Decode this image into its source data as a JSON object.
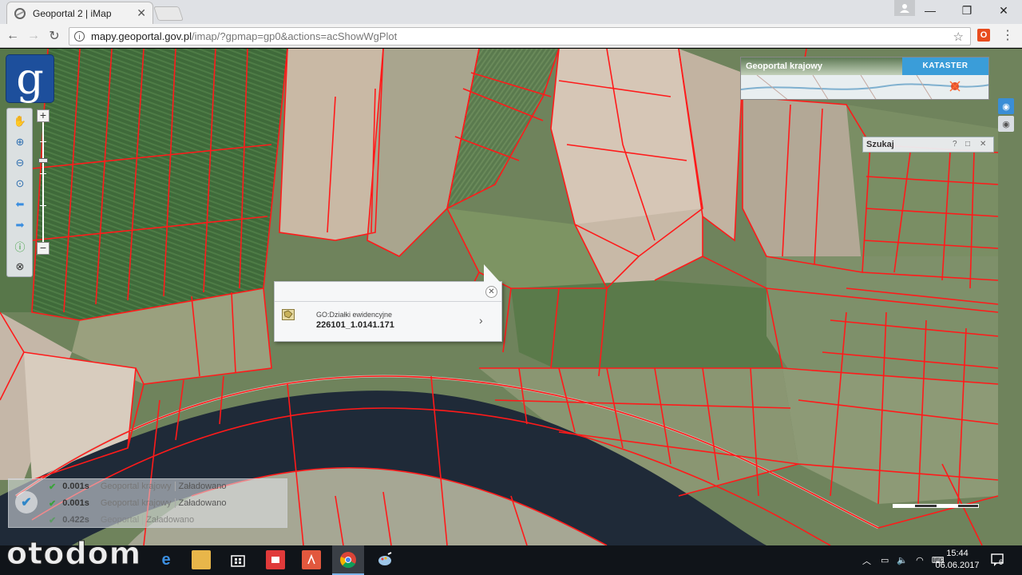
{
  "browser": {
    "tab_title": "Geoportal 2 | iMap",
    "url_host": "mapy.geoportal.gov.pl",
    "url_path": "/imap/?gpmap=gp0&actions=acShowWgPlot",
    "window_controls": [
      "—",
      "❐",
      "✕"
    ]
  },
  "map": {
    "logo_letter": "g",
    "overview": {
      "title": "Geoportal krajowy",
      "layer_button": "KATASTER"
    },
    "search_window": {
      "title": "Szukaj",
      "help": "?",
      "maximize": "□",
      "close": "✕"
    },
    "popup": {
      "layer_name": "GO:Działki ewidencyjne",
      "parcel_id": "226101_1.0141.171",
      "close": "✕",
      "more": "›"
    },
    "status": {
      "rows": [
        {
          "time": "0.001s",
          "source": "Geoportal krajowy",
          "state": "Załadowano"
        },
        {
          "time": "0.001s",
          "source": "Geoportal krajowy",
          "state": "Załadowano"
        },
        {
          "time": "0.422s",
          "source": "Geoportal",
          "state": "Załadowano"
        }
      ]
    }
  },
  "taskbar": {
    "time": "15:44",
    "date": "06.06.2017",
    "notifications": "6"
  },
  "watermark": "otodom",
  "colors": {
    "parcel_line": "#ff1a1a",
    "logo_bg": "#1d4f9c",
    "kataster_bg": "#3a9dd9",
    "river": "#1f2a38"
  }
}
